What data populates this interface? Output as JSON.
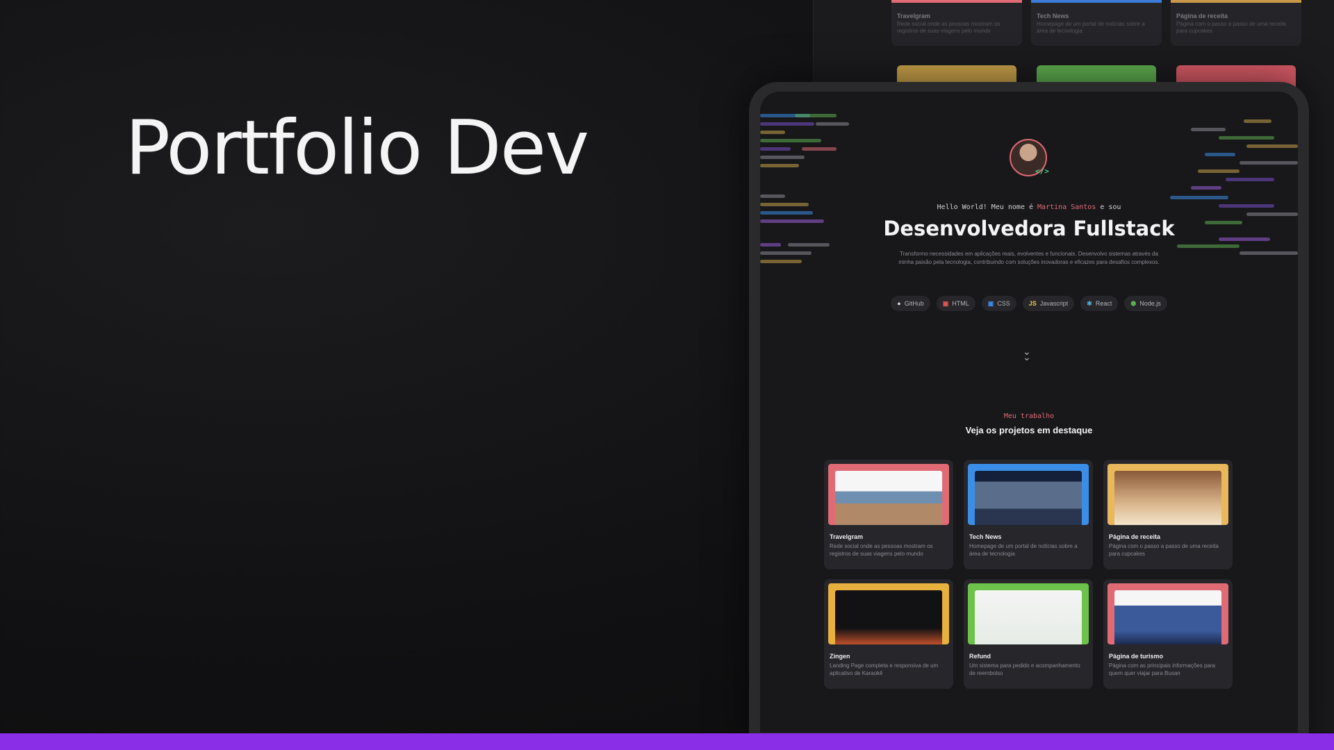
{
  "hero": {
    "title": "Portfolio Dev"
  },
  "colors": {
    "accent_bar": "#8b2ee8",
    "highlight": "#e06b74",
    "code_green": "#4ed08a"
  },
  "portfolio": {
    "avatar_badge": "</>",
    "hello_prefix": "Hello World! Meu nome é ",
    "name": "Martina Santos",
    "hello_suffix": " e sou",
    "headline": "Desenvolvedora Fullstack",
    "intro": "Transformo necessidades em aplicações reais, evolventes e funcionais. Desenvolvo sistemas através da minha paixão pela tecnologia, contribuindo com soluções inovadoras e eficazes para desafios complexos.",
    "badges": [
      {
        "label": "GitHub",
        "icon": "github-icon"
      },
      {
        "label": "HTML",
        "icon": "html-icon"
      },
      {
        "label": "CSS",
        "icon": "css-icon"
      },
      {
        "label": "Javascript",
        "icon": "js-icon"
      },
      {
        "label": "React",
        "icon": "react-icon"
      },
      {
        "label": "Node.js",
        "icon": "node-icon"
      }
    ],
    "scroll_icon": "chevrons-down-icon",
    "section_kicker": "Meu trabalho",
    "section_title": "Veja os projetos em destaque",
    "projects": [
      {
        "title": "Travelgram",
        "description": "Rede social onde as pessoas mostram os registros de suas viagens pelo mundo"
      },
      {
        "title": "Tech News",
        "description": "Homepage de um portal de notícias sobre a área de tecnologia"
      },
      {
        "title": "Página de receita",
        "description": "Página com o passo a passo de uma receita para cupcakes"
      },
      {
        "title": "Zingen",
        "description": "Landing Page completa e responsiva de um aplicativo de Karaokê"
      },
      {
        "title": "Refund",
        "description": "Um sistema para pedido e acompanhamento de reembolso"
      },
      {
        "title": "Página de turismo",
        "description": "Página com as principais informações para quem quer viajar para Busan"
      }
    ]
  },
  "background_projects": [
    {
      "title": "Travelgram",
      "description": "Rede social onde as pessoas mostram os registros de suas viagens pelo mundo"
    },
    {
      "title": "Tech News",
      "description": "Homepage de um portal de notícias sobre a área de tecnologia"
    },
    {
      "title": "Página de receita",
      "description": "Página com o passo a passo de uma receita para cupcakes"
    }
  ]
}
